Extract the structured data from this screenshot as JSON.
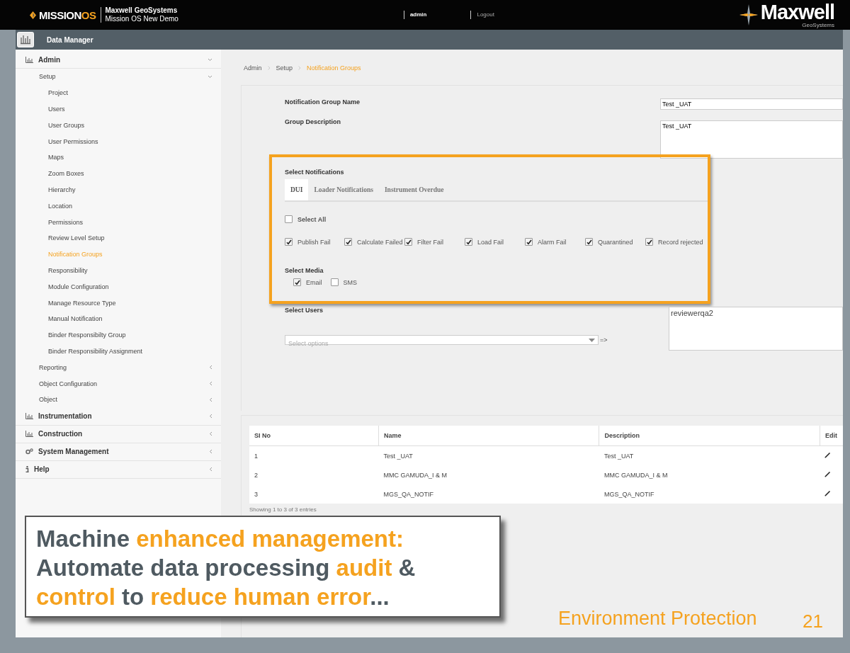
{
  "header": {
    "logo": [
      {
        "text": "MISSION",
        "highlight": false
      },
      {
        "text": "OS",
        "highlight": true
      }
    ],
    "company": "Maxwell GeoSystems",
    "subtitle": "Mission OS New Demo",
    "user": "admin",
    "logout": "Logout",
    "brand": "Maxwell",
    "brand_sub": "GeoSystems"
  },
  "app_bar": {
    "title": "Data Manager"
  },
  "sidebar": {
    "items": [
      {
        "label": "Admin",
        "kind": "chart",
        "expanded": true,
        "selected": false,
        "children": [
          {
            "label": "Setup",
            "expanded": true,
            "selected": false,
            "children": [
              {
                "label": "Project",
                "selected": false
              },
              {
                "label": "Users",
                "selected": false
              },
              {
                "label": "User Groups",
                "selected": false
              },
              {
                "label": "User Permissions",
                "selected": false
              },
              {
                "label": "Maps",
                "selected": false
              },
              {
                "label": "Zoom Boxes",
                "selected": false
              },
              {
                "label": "Hierarchy",
                "selected": false
              },
              {
                "label": "Location",
                "selected": false
              },
              {
                "label": "Permissions",
                "selected": false
              },
              {
                "label": "Review Level Setup",
                "selected": false
              },
              {
                "label": "Notification Groups",
                "selected": true
              },
              {
                "label": "Responsibility",
                "selected": false
              },
              {
                "label": "Module Configuration",
                "selected": false
              },
              {
                "label": "Manage Resource Type",
                "selected": false
              },
              {
                "label": "Manual Notification",
                "selected": false
              },
              {
                "label": "Binder Responsibilty Group",
                "selected": false
              },
              {
                "label": "Binder Responsibility Assignment",
                "selected": false
              }
            ]
          },
          {
            "label": "Reporting",
            "expanded": false,
            "selected": false
          },
          {
            "label": "Object Configuration",
            "expanded": false,
            "selected": false
          },
          {
            "label": "Object",
            "expanded": false,
            "selected": false
          }
        ]
      },
      {
        "label": "Instrumentation",
        "kind": "chart",
        "expanded": false,
        "selected": false
      },
      {
        "label": "Construction",
        "kind": "chart",
        "expanded": false,
        "selected": false
      },
      {
        "label": "System Management",
        "kind": "gear",
        "expanded": false,
        "selected": false
      },
      {
        "label": "Help",
        "kind": "info",
        "expanded": false,
        "selected": false
      }
    ]
  },
  "breadcrumb": [
    {
      "label": "Admin",
      "selected": false
    },
    {
      "label": "Setup",
      "selected": false
    },
    {
      "label": "Notification Groups",
      "selected": true
    }
  ],
  "form": {
    "name_label": "Notification Group Name",
    "name_value": "Test _UAT",
    "description_label": "Group Description",
    "description_value": "Test _UAT",
    "notifications": {
      "title": "Select Notifications",
      "tabs": [
        {
          "label": "DUI",
          "selected": true
        },
        {
          "label": "Loader Notifications",
          "selected": false
        },
        {
          "label": "Instrument Overdue",
          "selected": false
        }
      ],
      "select_all": {
        "label": "Select All",
        "checked": false
      },
      "options": [
        {
          "label": "Publish Fail",
          "checked": true
        },
        {
          "label": "Calculate Failed",
          "checked": true
        },
        {
          "label": "Filter Fail",
          "checked": true
        },
        {
          "label": "Load Fail",
          "checked": true
        },
        {
          "label": "Alarm Fail",
          "checked": true
        },
        {
          "label": "Quarantined",
          "checked": true
        },
        {
          "label": "Record rejected",
          "checked": true
        }
      ],
      "media_title": "Select Media",
      "media": [
        {
          "label": "Email",
          "checked": true
        },
        {
          "label": "SMS",
          "checked": false
        }
      ]
    },
    "users_label": "Select Users",
    "users_placeholder": "Select options",
    "arrow": "=>",
    "selected_users": "reviewerqa2"
  },
  "table": {
    "columns": [
      "SI No",
      "Name",
      "Description",
      "Edit"
    ],
    "rows": [
      [
        "1",
        "Test _UAT",
        "Test _UAT"
      ],
      [
        "2",
        "MMC GAMUDA_I & M",
        "MMC GAMUDA_I & M"
      ],
      [
        "3",
        "MGS_QA_NOTIF",
        "MGS_QA_NOTIF"
      ]
    ],
    "footer": "Showing 1 to 3 of 3 entries"
  },
  "callout": [
    {
      "text": "Machine ",
      "highlight": false
    },
    {
      "text": "enhanced management:",
      "highlight": true
    },
    {
      "text": " Automate data processing ",
      "highlight": false
    },
    {
      "text": "audit",
      "highlight": true
    },
    {
      "text": " & ",
      "highlight": false
    },
    {
      "text": "control",
      "highlight": true
    },
    {
      "text": " to ",
      "highlight": false
    },
    {
      "text": "reduce human error",
      "highlight": true
    },
    {
      "text": "...",
      "highlight": false
    }
  ],
  "slide_footer": {
    "title": "Environment Protection",
    "page": "21"
  }
}
